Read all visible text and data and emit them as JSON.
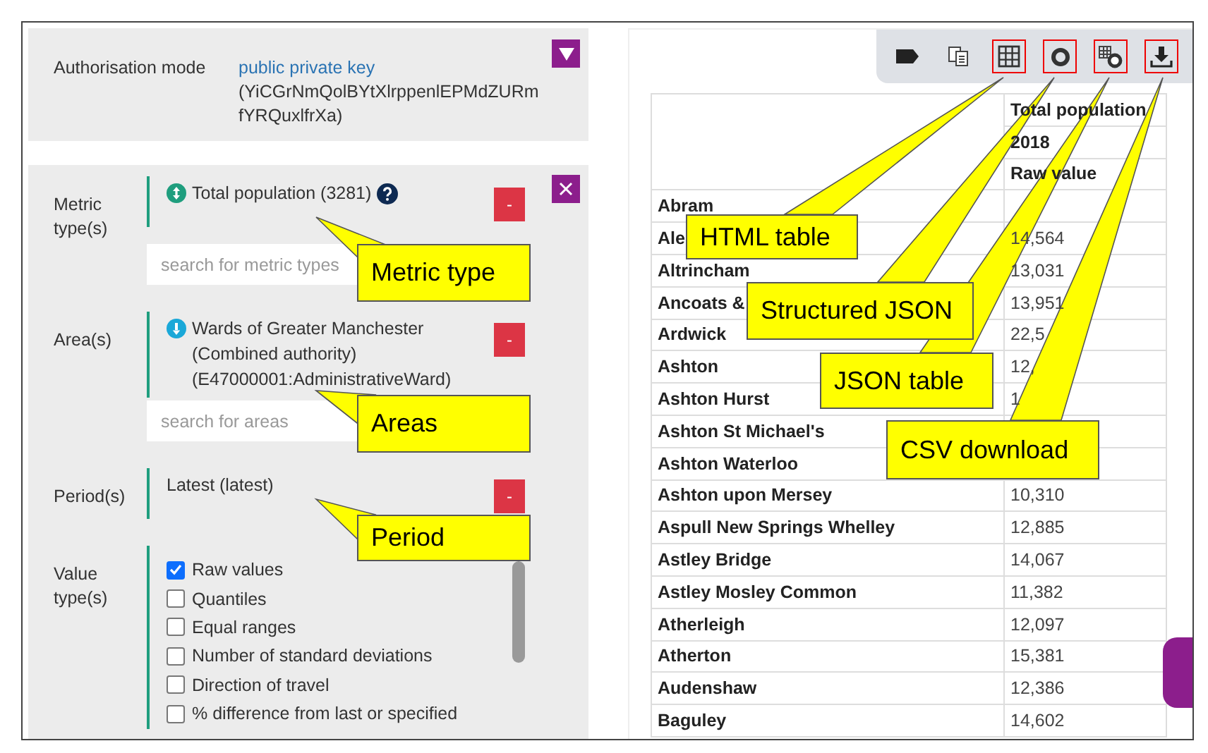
{
  "authorisation": {
    "label": "Authorisation mode",
    "mode": "public private key",
    "key": "(YiCGrNmQolBYtXlrppenlEPMdZURmfYRQuxlfrXa)"
  },
  "query": {
    "sections": [
      {
        "kind": "items",
        "label": "Metric type(s)",
        "items": [
          {
            "text": "Total population (3281)",
            "kind": "metric",
            "help": true,
            "remove": "-"
          }
        ],
        "search": {
          "placeholder": "search for metric types"
        }
      },
      {
        "kind": "items",
        "label": "Area(s)",
        "items": [
          {
            "text": "Wards of Greater Manchester (Combined authority) (E47000001:AdministrativeWard)",
            "kind": "area",
            "help": false,
            "remove": "-"
          }
        ],
        "search": {
          "placeholder": "search for areas"
        }
      },
      {
        "kind": "items",
        "label": "Period(s)",
        "items": [
          {
            "text": "Latest (latest)",
            "kind": "period",
            "help": false,
            "remove": "-"
          }
        ]
      },
      {
        "kind": "checks",
        "label": "Value type(s)",
        "options": [
          {
            "label": "Raw values",
            "checked": true
          },
          {
            "label": "Quantiles",
            "checked": false
          },
          {
            "label": "Equal ranges",
            "checked": false
          },
          {
            "label": "Number of standard deviations",
            "checked": false
          },
          {
            "label": "Direction of travel",
            "checked": false
          },
          {
            "label": "% difference from last or specified",
            "checked": false
          }
        ]
      }
    ]
  },
  "toolbar": [
    {
      "kind": "tag",
      "highlighted": false
    },
    {
      "kind": "copy",
      "highlighted": false
    },
    {
      "kind": "grid",
      "highlighted": true
    },
    {
      "kind": "ring",
      "highlighted": true
    },
    {
      "kind": "grid-ring",
      "highlighted": true
    },
    {
      "kind": "download",
      "highlighted": true
    }
  ],
  "table": {
    "header": [
      "Total population",
      "2018",
      "Raw value"
    ],
    "rows": [
      {
        "name": "Abram",
        "value": ""
      },
      {
        "name": "Ale",
        "value": "14,564"
      },
      {
        "name": "Altrincham",
        "value": "13,031"
      },
      {
        "name": "Ancoats &",
        "value": "13,951"
      },
      {
        "name": "Ardwick",
        "value": "22,5"
      },
      {
        "name": "Ashton",
        "value": "12,"
      },
      {
        "name": "Ashton Hurst",
        "value": "1"
      },
      {
        "name": "Ashton St Michael's",
        "value": ""
      },
      {
        "name": "Ashton Waterloo",
        "value": ""
      },
      {
        "name": "Ashton upon Mersey",
        "value": "10,310"
      },
      {
        "name": "Aspull New Springs Whelley",
        "value": "12,885"
      },
      {
        "name": "Astley Bridge",
        "value": "14,067"
      },
      {
        "name": "Astley Mosley Common",
        "value": "11,382"
      },
      {
        "name": "Atherleigh",
        "value": "12,097"
      },
      {
        "name": "Atherton",
        "value": "15,381"
      },
      {
        "name": "Audenshaw",
        "value": "12,386"
      },
      {
        "name": "Baguley",
        "value": "14,602"
      }
    ]
  },
  "callouts": [
    {
      "text": "Metric type"
    },
    {
      "text": "Areas"
    },
    {
      "text": "Period"
    },
    {
      "text": "HTML table"
    },
    {
      "text": "Structured JSON"
    },
    {
      "text": "JSON table"
    },
    {
      "text": "CSV download"
    }
  ]
}
